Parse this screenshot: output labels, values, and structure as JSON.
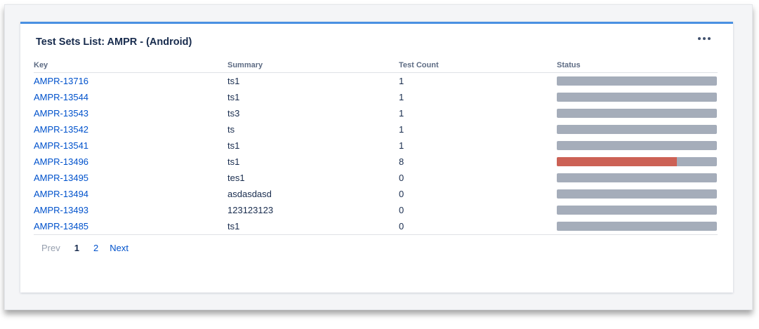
{
  "gadget": {
    "title": "Test Sets List: AMPR - (Android)"
  },
  "table": {
    "headers": {
      "key": "Key",
      "summary": "Summary",
      "count": "Test Count",
      "status": "Status"
    },
    "rows": [
      {
        "key": "AMPR-13716",
        "summary": "ts1",
        "count": "1",
        "fail_fraction": 0
      },
      {
        "key": "AMPR-13544",
        "summary": "ts1",
        "count": "1",
        "fail_fraction": 0
      },
      {
        "key": "AMPR-13543",
        "summary": "ts3",
        "count": "1",
        "fail_fraction": 0
      },
      {
        "key": "AMPR-13542",
        "summary": "ts",
        "count": "1",
        "fail_fraction": 0
      },
      {
        "key": "AMPR-13541",
        "summary": "ts1",
        "count": "1",
        "fail_fraction": 0
      },
      {
        "key": "AMPR-13496",
        "summary": "ts1",
        "count": "8",
        "fail_fraction": 0.75
      },
      {
        "key": "AMPR-13495",
        "summary": "tes1",
        "count": "0",
        "fail_fraction": 0
      },
      {
        "key": "AMPR-13494",
        "summary": "asdasdasd",
        "count": "0",
        "fail_fraction": 0
      },
      {
        "key": "AMPR-13493",
        "summary": "123123123",
        "count": "0",
        "fail_fraction": 0
      },
      {
        "key": "AMPR-13485",
        "summary": "ts1",
        "count": "0",
        "fail_fraction": 0
      }
    ]
  },
  "pager": {
    "prev": "Prev",
    "current": "1",
    "page2": "2",
    "next": "Next"
  },
  "colors": {
    "accent": "#4a90e2",
    "link": "#0052cc",
    "status_todo": "#a5adba",
    "status_fail": "#cc6155"
  },
  "icons": {
    "more": "more-horizontal-icon"
  }
}
